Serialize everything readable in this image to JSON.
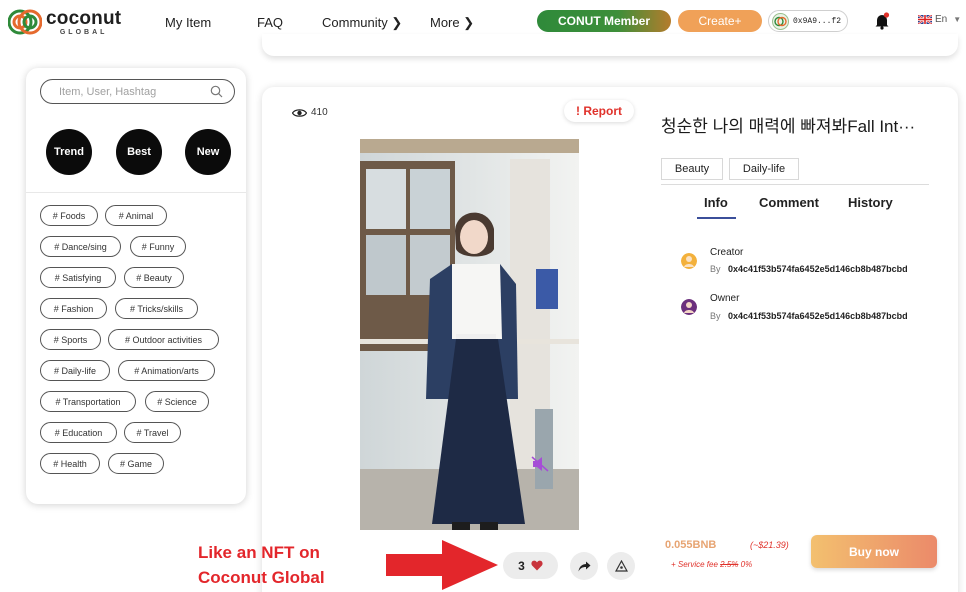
{
  "header": {
    "logo_word": "coconut",
    "logo_sub": "GLOBAL",
    "nav": [
      "My Item",
      "FAQ",
      "Community ❯",
      "More ❯"
    ],
    "member_label": "CONUT Member",
    "create_label": "Create+",
    "wallet_address": "0x9A9...f2",
    "language": "En"
  },
  "sidebar": {
    "search_placeholder": "Item, User, Hashtag",
    "filters": [
      "Trend",
      "Best",
      "New"
    ],
    "tags": [
      "# Foods",
      "# Animal",
      "# Dance/sing",
      "# Funny",
      "# Satisfying",
      "# Beauty",
      "# Fashion",
      "# Tricks/skills",
      "# Sports",
      "# Outdoor activities",
      "# Daily-life",
      "# Animation/arts",
      "# Transportation",
      "# Science",
      "# Education",
      "# Travel",
      "# Health",
      "# Game"
    ]
  },
  "item": {
    "views": "410",
    "report_label": "! Report",
    "title": "청순한 나의 매력에 빠져봐Fall Int···",
    "categories": [
      "Beauty",
      "Daily-life"
    ],
    "tabs": [
      "Info",
      "Comment",
      "History"
    ],
    "creator": {
      "role": "Creator",
      "by": "By",
      "address": "0x4c41f53b574fa6452e5d146cb8b487bcbd"
    },
    "owner": {
      "role": "Owner",
      "by": "By",
      "address": "0x4c41f53b574fa6452e5d146cb8b487bcbd"
    },
    "price": "0.055BNB",
    "price_usd": "(~$21.39)",
    "fee_prefix": "+ Service fee",
    "fee_old": "2.5%",
    "fee_new": "0%",
    "buy_label": "Buy now",
    "likes": "3"
  },
  "annotation": {
    "line1": "Like an NFT on",
    "line2": "Coconut Global"
  },
  "colors": {
    "accent_orange": "#f0a158",
    "member_green": "#2f8a3a",
    "report_red": "#e0322b",
    "annotation_red": "#e3262b",
    "tab_underline": "#3b4f9a"
  }
}
